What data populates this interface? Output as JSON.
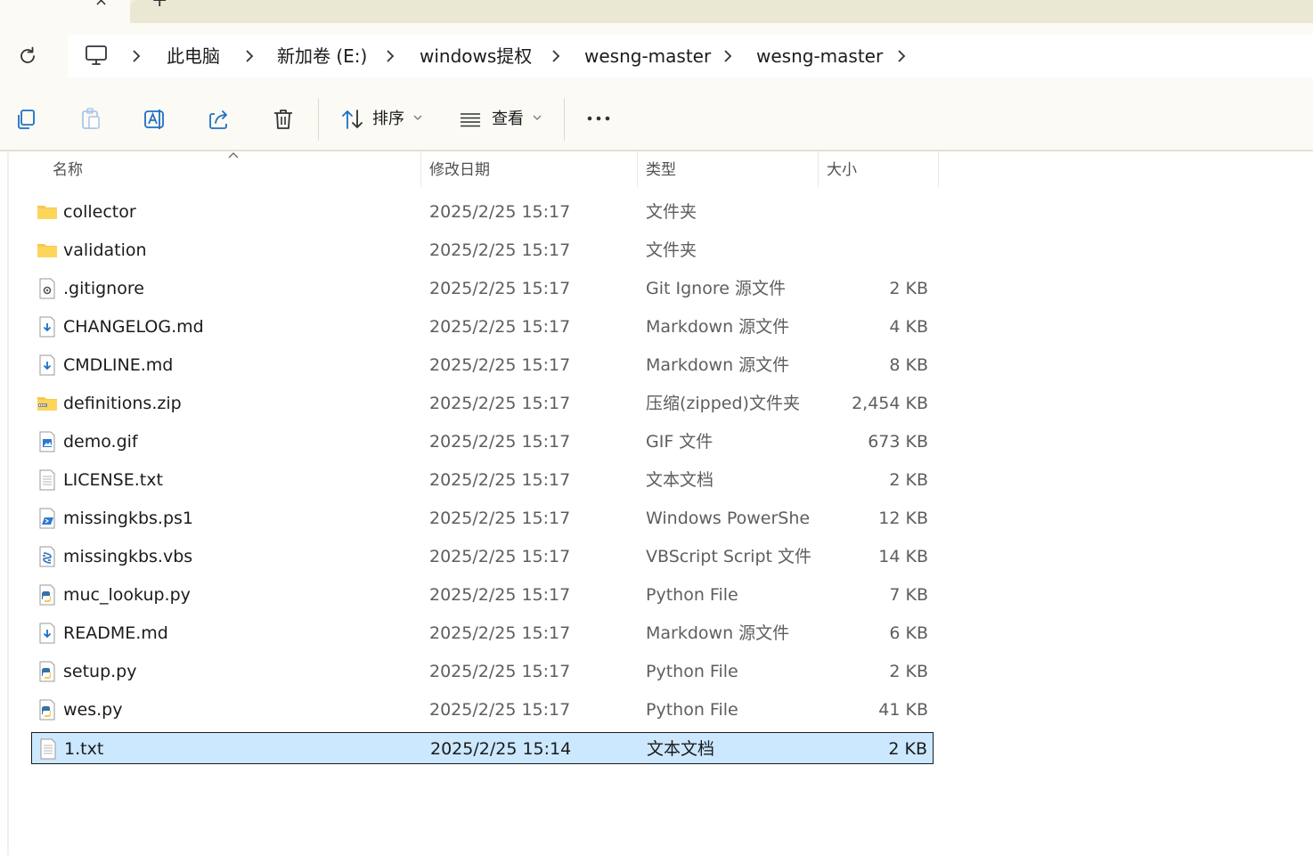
{
  "breadcrumb": [
    "此电脑",
    "新加卷 (E:)",
    "windows提权",
    "wesng-master",
    "wesng-master"
  ],
  "toolbar": {
    "sort_label": "排序",
    "view_label": "查看"
  },
  "columns": {
    "name": "名称",
    "date": "修改日期",
    "type": "类型",
    "size": "大小"
  },
  "files": [
    {
      "name": "collector",
      "date": "2025/2/25 15:17",
      "type": "文件夹",
      "size": "",
      "icon": "folder-icon"
    },
    {
      "name": "validation",
      "date": "2025/2/25 15:17",
      "type": "文件夹",
      "size": "",
      "icon": "folder-icon"
    },
    {
      "name": ".gitignore",
      "date": "2025/2/25 15:17",
      "type": "Git Ignore 源文件",
      "size": "2 KB",
      "icon": "settings-file-icon"
    },
    {
      "name": "CHANGELOG.md",
      "date": "2025/2/25 15:17",
      "type": "Markdown 源文件",
      "size": "4 KB",
      "icon": "markdown-file-icon"
    },
    {
      "name": "CMDLINE.md",
      "date": "2025/2/25 15:17",
      "type": "Markdown 源文件",
      "size": "8 KB",
      "icon": "markdown-file-icon"
    },
    {
      "name": "definitions.zip",
      "date": "2025/2/25 15:17",
      "type": "压缩(zipped)文件夹",
      "size": "2,454 KB",
      "icon": "zip-folder-icon"
    },
    {
      "name": "demo.gif",
      "date": "2025/2/25 15:17",
      "type": "GIF 文件",
      "size": "673 KB",
      "icon": "image-file-icon"
    },
    {
      "name": "LICENSE.txt",
      "date": "2025/2/25 15:17",
      "type": "文本文档",
      "size": "2 KB",
      "icon": "text-file-icon"
    },
    {
      "name": "missingkbs.ps1",
      "date": "2025/2/25 15:17",
      "type": "Windows PowerShe...",
      "size": "12 KB",
      "icon": "powershell-file-icon"
    },
    {
      "name": "missingkbs.vbs",
      "date": "2025/2/25 15:17",
      "type": "VBScript Script 文件",
      "size": "14 KB",
      "icon": "vbscript-file-icon"
    },
    {
      "name": "muc_lookup.py",
      "date": "2025/2/25 15:17",
      "type": "Python File",
      "size": "7 KB",
      "icon": "python-file-icon"
    },
    {
      "name": "README.md",
      "date": "2025/2/25 15:17",
      "type": "Markdown 源文件",
      "size": "6 KB",
      "icon": "markdown-file-icon"
    },
    {
      "name": "setup.py",
      "date": "2025/2/25 15:17",
      "type": "Python File",
      "size": "2 KB",
      "icon": "python-file-icon"
    },
    {
      "name": "wes.py",
      "date": "2025/2/25 15:17",
      "type": "Python File",
      "size": "41 KB",
      "icon": "python-file-icon"
    },
    {
      "name": "1.txt",
      "date": "2025/2/25 15:14",
      "type": "文本文档",
      "size": "2 KB",
      "icon": "text-file-icon",
      "selected": true
    }
  ],
  "colors": {
    "selection": "#cce8ff",
    "chrome": "#fbfaf5",
    "folder": "#f8c74a"
  }
}
